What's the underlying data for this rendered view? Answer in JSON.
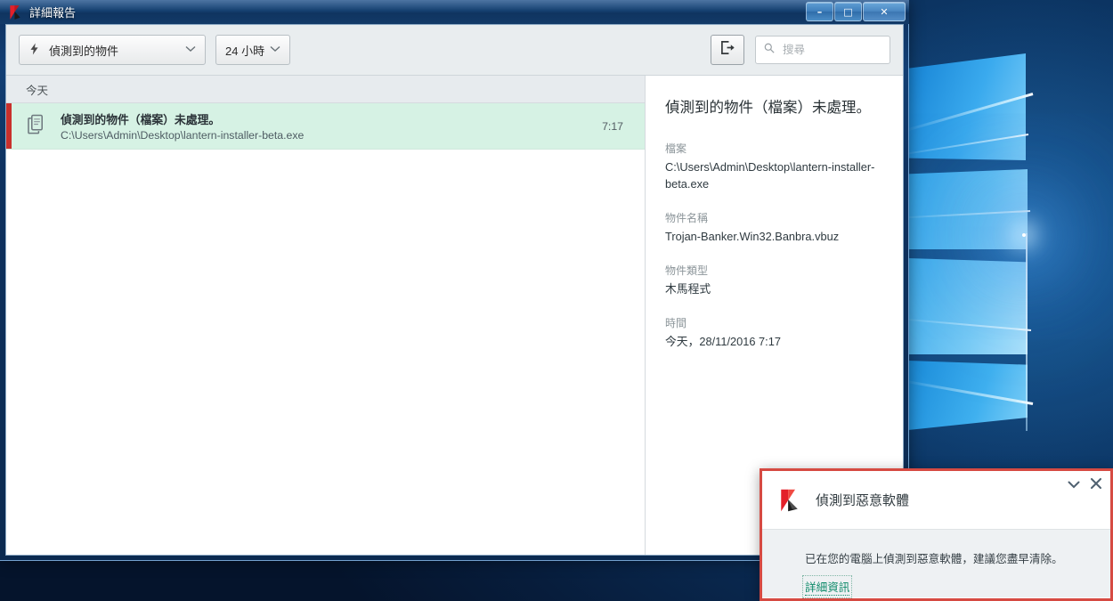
{
  "window": {
    "title": "詳細報告",
    "icon": "kaspersky-logo",
    "buttons": {
      "minimize": "–",
      "maximize": "□",
      "close": "✕"
    }
  },
  "toolbar": {
    "filter_dropdown": {
      "icon": "lightning-bolt-icon",
      "value": "偵測到的物件",
      "chevron": "⌄"
    },
    "period_dropdown": {
      "value": "24 小時",
      "chevron": "⌄"
    },
    "export_button_icon": "export-icon",
    "search": {
      "icon": "search-icon",
      "value": "",
      "placeholder": "搜尋"
    }
  },
  "list": {
    "group_header": "今天",
    "rows": [
      {
        "icon": "document-icon",
        "title": "偵測到的物件（檔案）未處理。",
        "path": "C:\\Users\\Admin\\Desktop\\lantern-installer-beta.exe",
        "time": "7:17",
        "severity_color": "#c9302c",
        "selected": true
      }
    ]
  },
  "detail": {
    "title": "偵測到的物件（檔案）未處理。",
    "fields": [
      {
        "label": "檔案",
        "value": "C:\\Users\\Admin\\Desktop\\lantern-installer-beta.exe"
      },
      {
        "label": "物件名稱",
        "value": "Trojan-Banker.Win32.Banbra.vbuz"
      },
      {
        "label": "物件類型",
        "value": "木馬程式"
      },
      {
        "label": "時間",
        "value": "今天，28/11/2016 7:17"
      }
    ]
  },
  "notification": {
    "logo": "kaspersky-logo",
    "title": "偵測到惡意軟體",
    "message": "已在您的電腦上偵測到惡意軟體，建議您盡早清除。",
    "link": "詳細資訊",
    "collapse_icon": "chevron-down-icon",
    "close_icon": "close-icon",
    "border_color": "#d64a42",
    "link_color": "#0e8a6a"
  }
}
